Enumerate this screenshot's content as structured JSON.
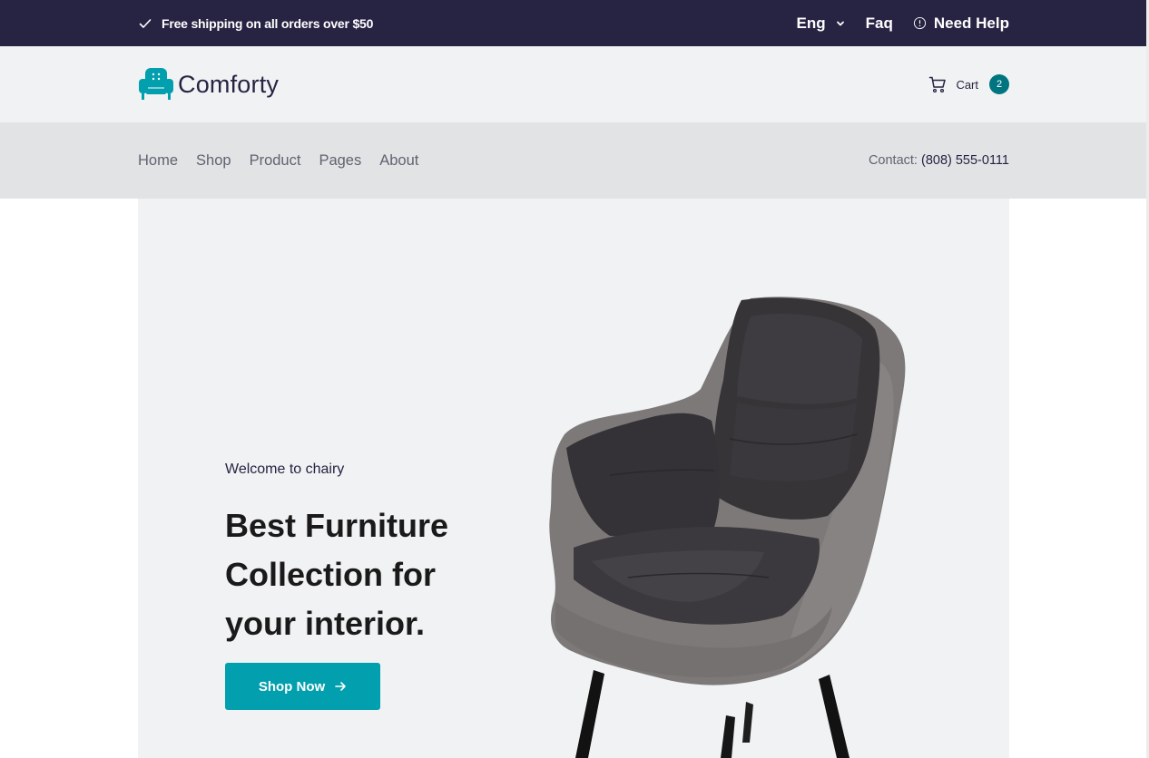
{
  "topbar": {
    "shipping_text": "Free shipping on all orders over $50",
    "language": "Eng",
    "faq": "Faq",
    "help": "Need Help"
  },
  "header": {
    "brand": "Comforty",
    "cart_label": "Cart",
    "cart_count": "2"
  },
  "nav": {
    "items": [
      {
        "label": "Home"
      },
      {
        "label": "Shop"
      },
      {
        "label": "Product"
      },
      {
        "label": "Pages"
      },
      {
        "label": "About"
      }
    ],
    "contact_label": "Contact:",
    "contact_phone": "(808) 555-0111"
  },
  "hero": {
    "welcome": "Welcome to chairy",
    "headline": "Best Furniture Collection for your interior.",
    "button_label": "Shop Now"
  },
  "colors": {
    "topbar_bg": "#272343",
    "accent": "#029fae",
    "badge": "#007580"
  },
  "icons": [
    "check-icon",
    "chevron-down-icon",
    "info-icon",
    "sofa-logo-icon",
    "cart-icon",
    "arrow-right-icon"
  ]
}
